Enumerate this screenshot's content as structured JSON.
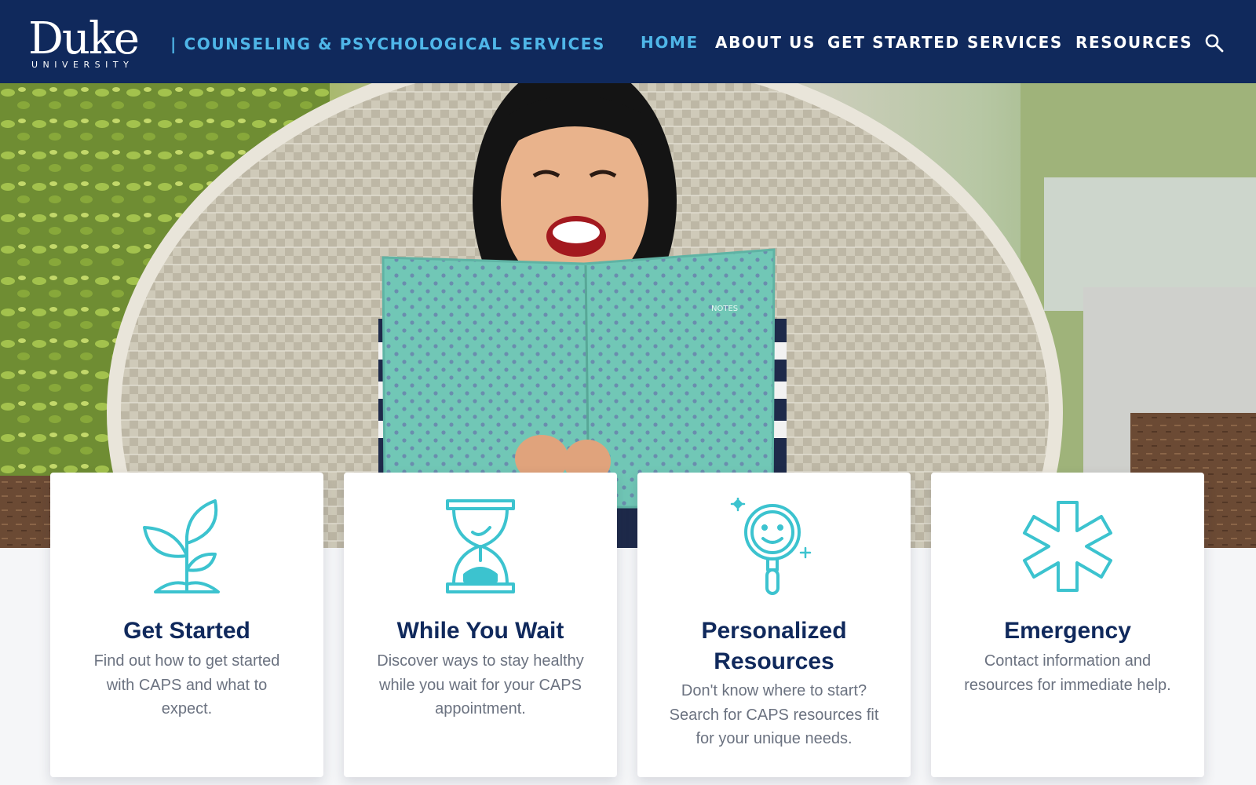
{
  "header": {
    "logo_word": "Duke",
    "logo_sub": "UNIVERSITY",
    "department": "| COUNSELING & PSYCHOLOGICAL SERVICES",
    "nav": [
      {
        "label": "HOME",
        "active": true
      },
      {
        "label": "ABOUT US",
        "active": false
      },
      {
        "label": "GET STARTED",
        "active": false
      },
      {
        "label": "SERVICES",
        "active": false
      },
      {
        "label": "RESOURCES",
        "active": false
      }
    ],
    "search_icon": "search-icon"
  },
  "hero": {
    "notebook_label": "NOTES"
  },
  "cards": [
    {
      "icon": "sprout-icon",
      "title": "Get Started",
      "description": "Find out how to get started with CAPS and what to expect."
    },
    {
      "icon": "hourglass-icon",
      "title": "While You Wait",
      "description": "Discover ways to stay healthy while you wait for your CAPS appointment."
    },
    {
      "icon": "smiley-magnifier-icon",
      "title": "Personalized Resources",
      "description": "Don't know where to start? Search for CAPS resources fit for your unique needs."
    },
    {
      "icon": "medical-star-icon",
      "title": "Emergency",
      "description": "Contact information and resources for immediate help."
    }
  ],
  "colors": {
    "header_bg": "#10295c",
    "accent": "#4fb6e8",
    "icon": "#3cc3cf",
    "title": "#10295c",
    "body_text": "#6b7280"
  }
}
